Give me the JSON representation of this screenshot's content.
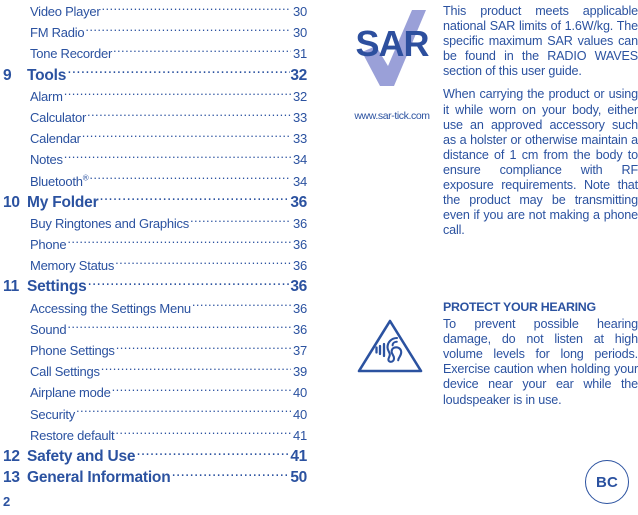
{
  "colors": {
    "text_blue": "#2b52a0",
    "sar_dark_blue": "#2d4f9e",
    "sar_check_lavender": "#9aa0d8"
  },
  "toc": {
    "rows": [
      {
        "type": "sub",
        "number": "",
        "title": "Video Player",
        "page": "30"
      },
      {
        "type": "sub",
        "number": "",
        "title": "FM Radio",
        "page": "30"
      },
      {
        "type": "sub",
        "number": "",
        "title": "Tone Recorder",
        "page": "31"
      },
      {
        "type": "chapter",
        "number": "9",
        "title": "Tools",
        "page": "32"
      },
      {
        "type": "sub",
        "number": "",
        "title": "Alarm",
        "page": "32"
      },
      {
        "type": "sub",
        "number": "",
        "title": "Calculator",
        "page": "33"
      },
      {
        "type": "sub",
        "number": "",
        "title": "Calendar",
        "page": "33"
      },
      {
        "type": "sub",
        "number": "",
        "title": "Notes",
        "page": "34"
      },
      {
        "type": "sub",
        "number": "",
        "title": "Bluetooth®",
        "page": "34"
      },
      {
        "type": "chapter",
        "number": "10",
        "title": "My Folder",
        "page": "36"
      },
      {
        "type": "sub",
        "number": "",
        "title": "Buy Ringtones and Graphics",
        "page": "36"
      },
      {
        "type": "sub",
        "number": "",
        "title": "Phone",
        "page": "36"
      },
      {
        "type": "sub",
        "number": "",
        "title": "Memory Status",
        "page": "36"
      },
      {
        "type": "chapter",
        "number": "11",
        "title": "Settings",
        "page": "36"
      },
      {
        "type": "sub",
        "number": "",
        "title": "Accessing the Settings Menu",
        "page": "36"
      },
      {
        "type": "sub",
        "number": "",
        "title": "Sound",
        "page": "36"
      },
      {
        "type": "sub",
        "number": "",
        "title": "Phone Settings",
        "page": "37"
      },
      {
        "type": "sub",
        "number": "",
        "title": "Call Settings",
        "page": "39"
      },
      {
        "type": "sub",
        "number": "",
        "title": "Airplane mode",
        "page": "40"
      },
      {
        "type": "sub",
        "number": "",
        "title": "Security",
        "page": "40"
      },
      {
        "type": "sub",
        "number": "",
        "title": "Restore default",
        "page": "41"
      },
      {
        "type": "chapter",
        "number": "12",
        "title": "Safety and Use",
        "page": "41"
      },
      {
        "type": "chapter",
        "number": "13",
        "title": "General Information",
        "page": "50"
      }
    ],
    "page_number": "2"
  },
  "sar": {
    "logo_text": "SAR",
    "url": "www.sar-tick.com",
    "paragraphs": [
      "This product meets applicable national SAR limits of 1.6W/kg. The specific maximum SAR values can be found in the RADIO WAVES section of this user guide.",
      "When carrying the product or using it while worn on your body, either use an approved accessory such as a holster or otherwise maintain a distance of 1 cm from the body to ensure compliance with RF exposure requirements.  Note that the product may be transmitting even if you are not making a phone call."
    ]
  },
  "hearing": {
    "heading": "PROTECT YOUR HEARING",
    "body": "To prevent possible hearing damage, do not listen at high volume levels for long periods. Exercise caution when holding your device near your ear while the loudspeaker is in use."
  },
  "badge": {
    "label": "BC"
  }
}
